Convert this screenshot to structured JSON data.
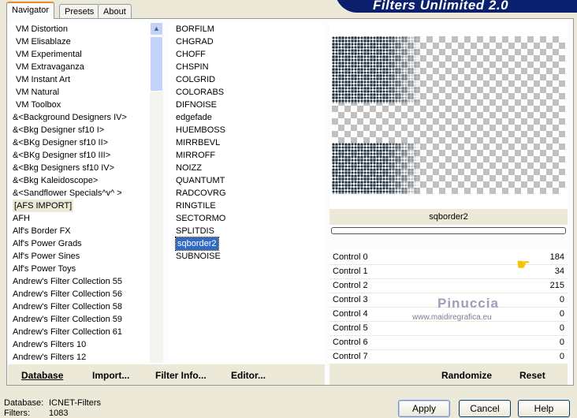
{
  "logo": "Filters Unlimited 2.0",
  "tabs": [
    "Navigator",
    "Presets",
    "About"
  ],
  "categories": [
    "VM Distortion",
    "VM Elisablaze",
    "VM Experimental",
    "VM Extravaganza",
    "VM Instant Art",
    "VM Natural",
    "VM Toolbox",
    "&<Background Designers IV>",
    "&<Bkg Designer sf10 I>",
    "&<BKg Designer sf10 II>",
    "&<BKg Designer sf10 III>",
    "&<Bkg Designers sf10 IV>",
    "&<Bkg Kaleidoscope>",
    "&<Sandflower Specials^v^ >",
    "[AFS IMPORT]",
    "AFH",
    "Alf's Border FX",
    "Alf's Power Grads",
    "Alf's Power Sines",
    "Alf's Power Toys",
    "Andrew's Filter Collection 55",
    "Andrew's Filter Collection 56",
    "Andrew's Filter Collection 58",
    "Andrew's Filter Collection 59",
    "Andrew's Filter Collection 61",
    "Andrew's Filters 10",
    "Andrew's Filters 12"
  ],
  "highlighted_category": 14,
  "filters": [
    "BORFILM",
    "CHGRAD",
    "CHOFF",
    "CHSPIN",
    "COLGRID",
    "COLORABS",
    "DIFNOISE",
    "edgefade",
    "HUEMBOSS",
    "MIRRBEVL",
    "MIRROFF",
    "NOIZZ",
    "QUANTUMT",
    "RADCOVRG",
    "RINGTILE",
    "SECTORMO",
    "SPLITDIS",
    "sqborder2",
    "SUBNOISE"
  ],
  "selected_filter": 17,
  "preview_label": "sqborder2",
  "controls": [
    {
      "label": "Control 0",
      "value": "184"
    },
    {
      "label": "Control 1",
      "value": "34"
    },
    {
      "label": "Control 2",
      "value": "215"
    },
    {
      "label": "Control 3",
      "value": "0"
    },
    {
      "label": "Control 4",
      "value": "0"
    },
    {
      "label": "Control 5",
      "value": "0"
    },
    {
      "label": "Control 6",
      "value": "0"
    },
    {
      "label": "Control 7",
      "value": "0"
    }
  ],
  "watermark": {
    "name": "Pinuccia",
    "url": "www.maidiregrafica.eu"
  },
  "left_buttons": [
    "Database",
    "Import...",
    "Filter Info...",
    "Editor..."
  ],
  "right_buttons": [
    "Randomize",
    "Reset"
  ],
  "status": {
    "database_label": "Database:",
    "database_value": "ICNET-Filters",
    "filters_label": "Filters:",
    "filters_value": "1083"
  },
  "dialog_buttons": [
    "Apply",
    "Cancel",
    "Help"
  ]
}
